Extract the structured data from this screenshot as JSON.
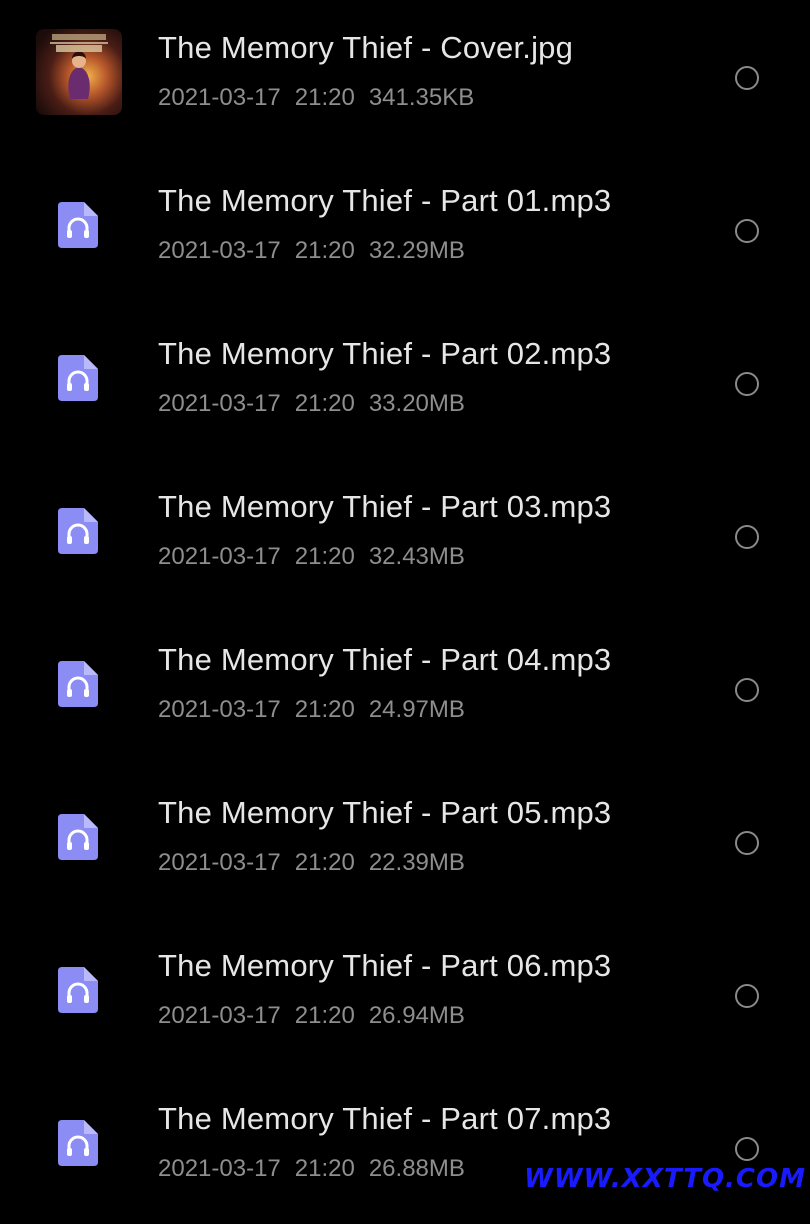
{
  "files": [
    {
      "name": "The Memory Thief - Cover.jpg",
      "date": "2021-03-17",
      "time": "21:20",
      "size": "341.35KB",
      "icon": "image-thumbnail"
    },
    {
      "name": "The Memory Thief - Part 01.mp3",
      "date": "2021-03-17",
      "time": "21:20",
      "size": "32.29MB",
      "icon": "audio-file-icon"
    },
    {
      "name": "The Memory Thief - Part 02.mp3",
      "date": "2021-03-17",
      "time": "21:20",
      "size": "33.20MB",
      "icon": "audio-file-icon"
    },
    {
      "name": "The Memory Thief - Part 03.mp3",
      "date": "2021-03-17",
      "time": "21:20",
      "size": "32.43MB",
      "icon": "audio-file-icon"
    },
    {
      "name": "The Memory Thief - Part 04.mp3",
      "date": "2021-03-17",
      "time": "21:20",
      "size": "24.97MB",
      "icon": "audio-file-icon"
    },
    {
      "name": "The Memory Thief - Part 05.mp3",
      "date": "2021-03-17",
      "time": "21:20",
      "size": "22.39MB",
      "icon": "audio-file-icon"
    },
    {
      "name": "The Memory Thief - Part 06.mp3",
      "date": "2021-03-17",
      "time": "21:20",
      "size": "26.94MB",
      "icon": "audio-file-icon"
    },
    {
      "name": "The Memory Thief - Part 07.mp3",
      "date": "2021-03-17",
      "time": "21:20",
      "size": "26.88MB",
      "icon": "audio-file-icon"
    }
  ],
  "watermark": "WWW.XXTTQ.COM",
  "colors": {
    "background": "#000000",
    "file_name": "#e6e6e6",
    "meta_text": "#8e8e8e",
    "audio_icon": "#8c8cf5",
    "radio_border": "#8a8a8a",
    "watermark": "#1a1aff"
  }
}
